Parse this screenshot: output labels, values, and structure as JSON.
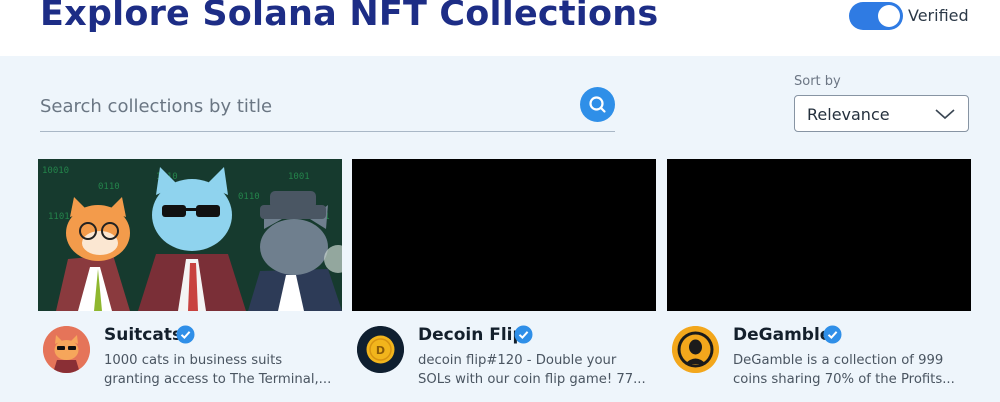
{
  "header": {
    "title": "Explore Solana NFT Collections",
    "verified_label": "Verified",
    "verified_on": true
  },
  "search": {
    "placeholder": "Search collections by title",
    "value": "",
    "button_icon": "search-icon"
  },
  "sort": {
    "label": "Sort by",
    "value": "Relevance",
    "icon": "chevron-down-icon"
  },
  "collections": [
    {
      "title": "Suitcats",
      "verified": true,
      "description_line1": "1000 cats in business suits",
      "description_line2": "granting access to The Terminal,..."
    },
    {
      "title": "Decoin Flip",
      "verified": true,
      "description_line1": "decoin flip#120 - Double your",
      "description_line2": "SOLs with our coin flip game! 77..."
    },
    {
      "title": "DeGamble",
      "verified": true,
      "description_line1": "DeGamble is a collection of 999",
      "description_line2": "coins sharing 70% of the Profits..."
    }
  ],
  "colors": {
    "title": "#1d2d86",
    "accent": "#2f7be3",
    "background": "#eef5fb",
    "verified_badge": "#2f8fe8"
  }
}
